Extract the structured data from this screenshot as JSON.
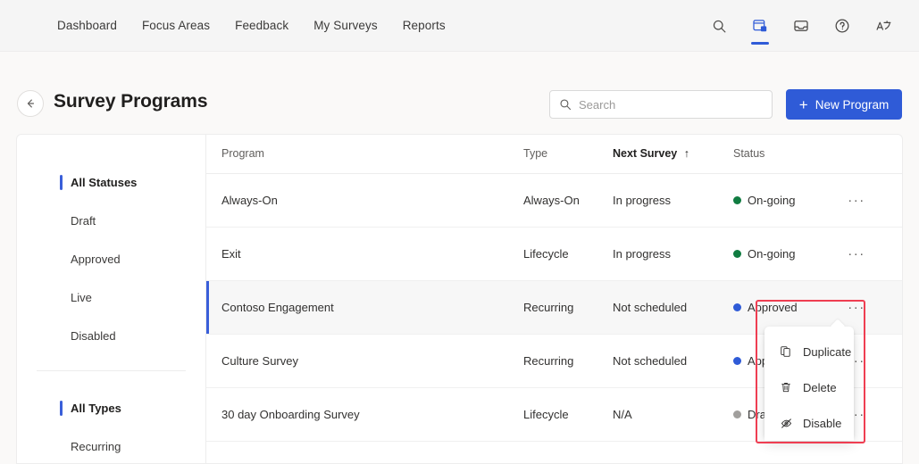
{
  "topnav": {
    "links": [
      {
        "label": "Dashboard"
      },
      {
        "label": "Focus Areas"
      },
      {
        "label": "Feedback"
      },
      {
        "label": "My Surveys"
      },
      {
        "label": "Reports"
      }
    ],
    "icons": [
      {
        "name": "search-icon",
        "active": false
      },
      {
        "name": "create-card-icon",
        "active": true
      },
      {
        "name": "inbox-icon",
        "active": false
      },
      {
        "name": "help-icon",
        "active": false
      },
      {
        "name": "translate-icon",
        "active": false
      }
    ],
    "accent": "#2f5bd7"
  },
  "header": {
    "back_label": "←",
    "title": "Survey Programs",
    "search": {
      "placeholder": "Search",
      "value": ""
    },
    "new_button": {
      "label": "New Program",
      "plus": "+",
      "color": "#2f5bd7"
    }
  },
  "filters": {
    "statuses": [
      {
        "label": "All Statuses",
        "selected": true
      },
      {
        "label": "Draft",
        "selected": false
      },
      {
        "label": "Approved",
        "selected": false
      },
      {
        "label": "Live",
        "selected": false
      },
      {
        "label": "Disabled",
        "selected": false
      }
    ],
    "types": [
      {
        "label": "All Types",
        "selected": true
      },
      {
        "label": "Recurring",
        "selected": false
      }
    ],
    "accent": "#3a5fd9"
  },
  "table": {
    "columns": [
      {
        "key": "program",
        "label": "Program",
        "sorted": false
      },
      {
        "key": "type",
        "label": "Type",
        "sorted": false
      },
      {
        "key": "next",
        "label": "Next Survey",
        "sorted": true,
        "sort_arrow": "↑"
      },
      {
        "key": "status",
        "label": "Status",
        "sorted": false
      },
      {
        "key": "actions",
        "label": "",
        "sorted": false
      }
    ],
    "rows": [
      {
        "program": "Always-On",
        "type": "Always-On",
        "next": "In progress",
        "status": "On-going",
        "status_color": "#107c41",
        "selected": false,
        "actions": "···"
      },
      {
        "program": "Exit",
        "type": "Lifecycle",
        "next": "In progress",
        "status": "On-going",
        "status_color": "#107c41",
        "selected": false,
        "actions": "···"
      },
      {
        "program": "Contoso Engagement",
        "type": "Recurring",
        "next": "Not scheduled",
        "status": "Approved",
        "status_color": "#2f5bd7",
        "selected": true,
        "actions": "···"
      },
      {
        "program": "Culture Survey",
        "type": "Recurring",
        "next": "Not scheduled",
        "status": "Approved",
        "status_color": "#2f5bd7",
        "selected": false,
        "actions": "···"
      },
      {
        "program": "30 day Onboarding Survey",
        "type": "Lifecycle",
        "next": "N/A",
        "status": "Draft",
        "status_color": "#a19f9d",
        "selected": false,
        "actions": "···"
      }
    ]
  },
  "context_menu": {
    "items": [
      {
        "label": "Duplicate",
        "icon": "duplicate-icon"
      },
      {
        "label": "Delete",
        "icon": "trash-icon"
      },
      {
        "label": "Disable",
        "icon": "eye-off-icon"
      }
    ]
  },
  "annotation": {
    "color": "#ef3e52"
  }
}
